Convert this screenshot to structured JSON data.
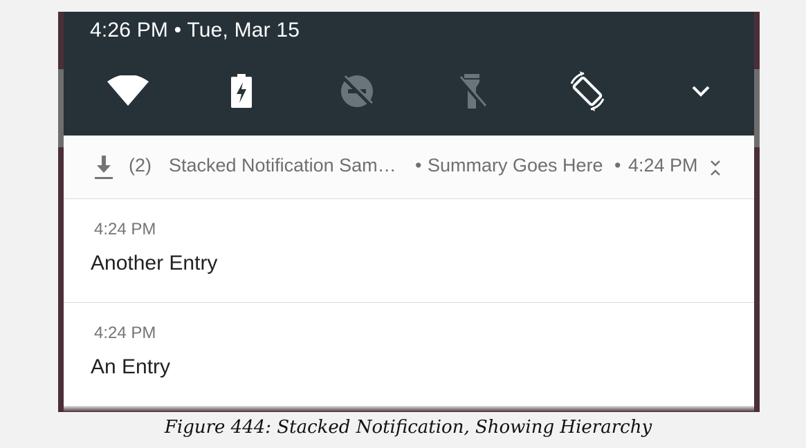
{
  "status_bar": {
    "datetime": "4:26 PM • Tue, Mar 15"
  },
  "quick_settings": {
    "tiles": [
      {
        "icon": "wifi-icon",
        "enabled": true
      },
      {
        "icon": "battery-charging-icon",
        "enabled": true
      },
      {
        "icon": "do-not-disturb-off-icon",
        "enabled": false
      },
      {
        "icon": "flashlight-off-icon",
        "enabled": false
      },
      {
        "icon": "auto-rotate-icon",
        "enabled": true
      },
      {
        "icon": "chevron-down-icon",
        "enabled": true
      }
    ]
  },
  "notification": {
    "icon": "download-icon",
    "count": "(2)",
    "app_name": "Stacked Notification Sam…",
    "separator": "•",
    "summary": "Summary Goes Here",
    "time": "4:24 PM",
    "collapse_icon": "collapse-icon",
    "entries": [
      {
        "time": "4:24 PM",
        "title": "Another Entry"
      },
      {
        "time": "4:24 PM",
        "title": "An Entry"
      }
    ]
  },
  "caption": "Figure 444: Stacked Notification, Showing Hierarchy",
  "colors": {
    "shade_background": "#263238",
    "wallpaper": "#4b2f38",
    "card_background": "#ffffff"
  }
}
